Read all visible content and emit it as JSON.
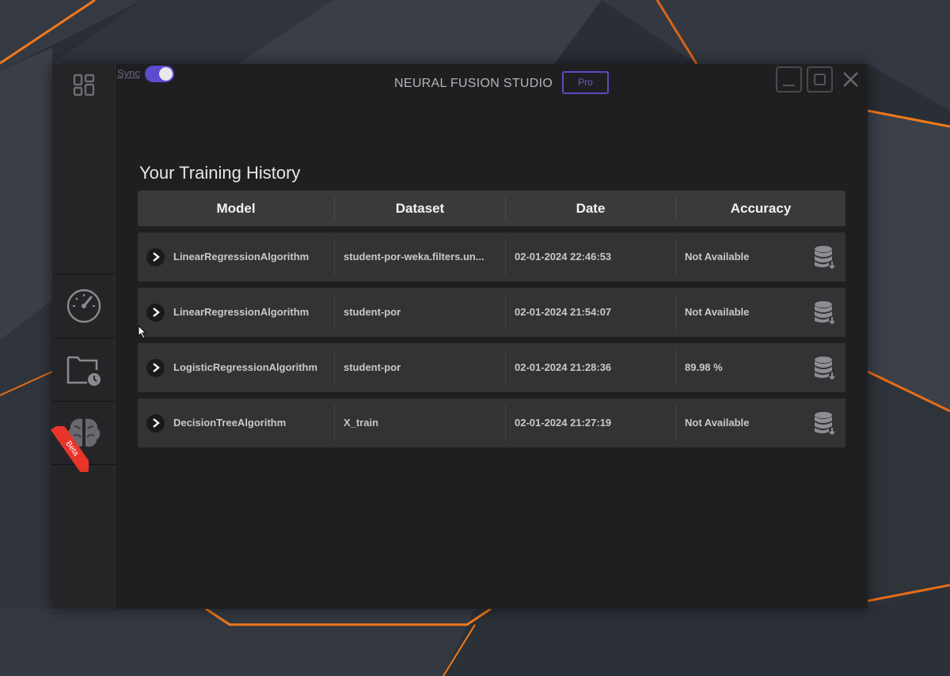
{
  "window": {
    "app_title": "NEURAL FUSION STUDIO",
    "badge": "Pro",
    "sync_label": "Sync",
    "sync_on": true,
    "controls": [
      "minimize-icon",
      "maximize-icon",
      "close-icon"
    ]
  },
  "sidebar": {
    "items": [
      {
        "icon": "dashboard-grid-icon"
      },
      {
        "icon": "speedometer-icon"
      },
      {
        "icon": "folder-clock-icon"
      },
      {
        "icon": "brain-icon",
        "ribbon": "Beta"
      }
    ]
  },
  "main": {
    "title": "Your Training History",
    "columns": [
      "Model",
      "Dataset",
      "Date",
      "Accuracy"
    ],
    "rows": [
      {
        "model": "LinearRegressionAlgorithm",
        "dataset": "student-por-weka.filters.un...",
        "date": "02-01-2024 22:46:53",
        "accuracy": "Not Available"
      },
      {
        "model": "LinearRegressionAlgorithm",
        "dataset": "student-por",
        "date": "02-01-2024 21:54:07",
        "accuracy": "Not Available"
      },
      {
        "model": "LogisticRegressionAlgorithm",
        "dataset": "student-por",
        "date": "02-01-2024 21:28:36",
        "accuracy": "89.98 %"
      },
      {
        "model": "DecisionTreeAlgorithm",
        "dataset": "X_train",
        "date": "02-01-2024 21:27:19",
        "accuracy": "Not Available"
      }
    ],
    "row_icons": [
      "chevron-right-icon",
      "database-icon"
    ]
  },
  "colors": {
    "accent": "#5d4bd0",
    "beta_ribbon": "#e8342a",
    "wallpaper_glow": "#f07a1c"
  }
}
